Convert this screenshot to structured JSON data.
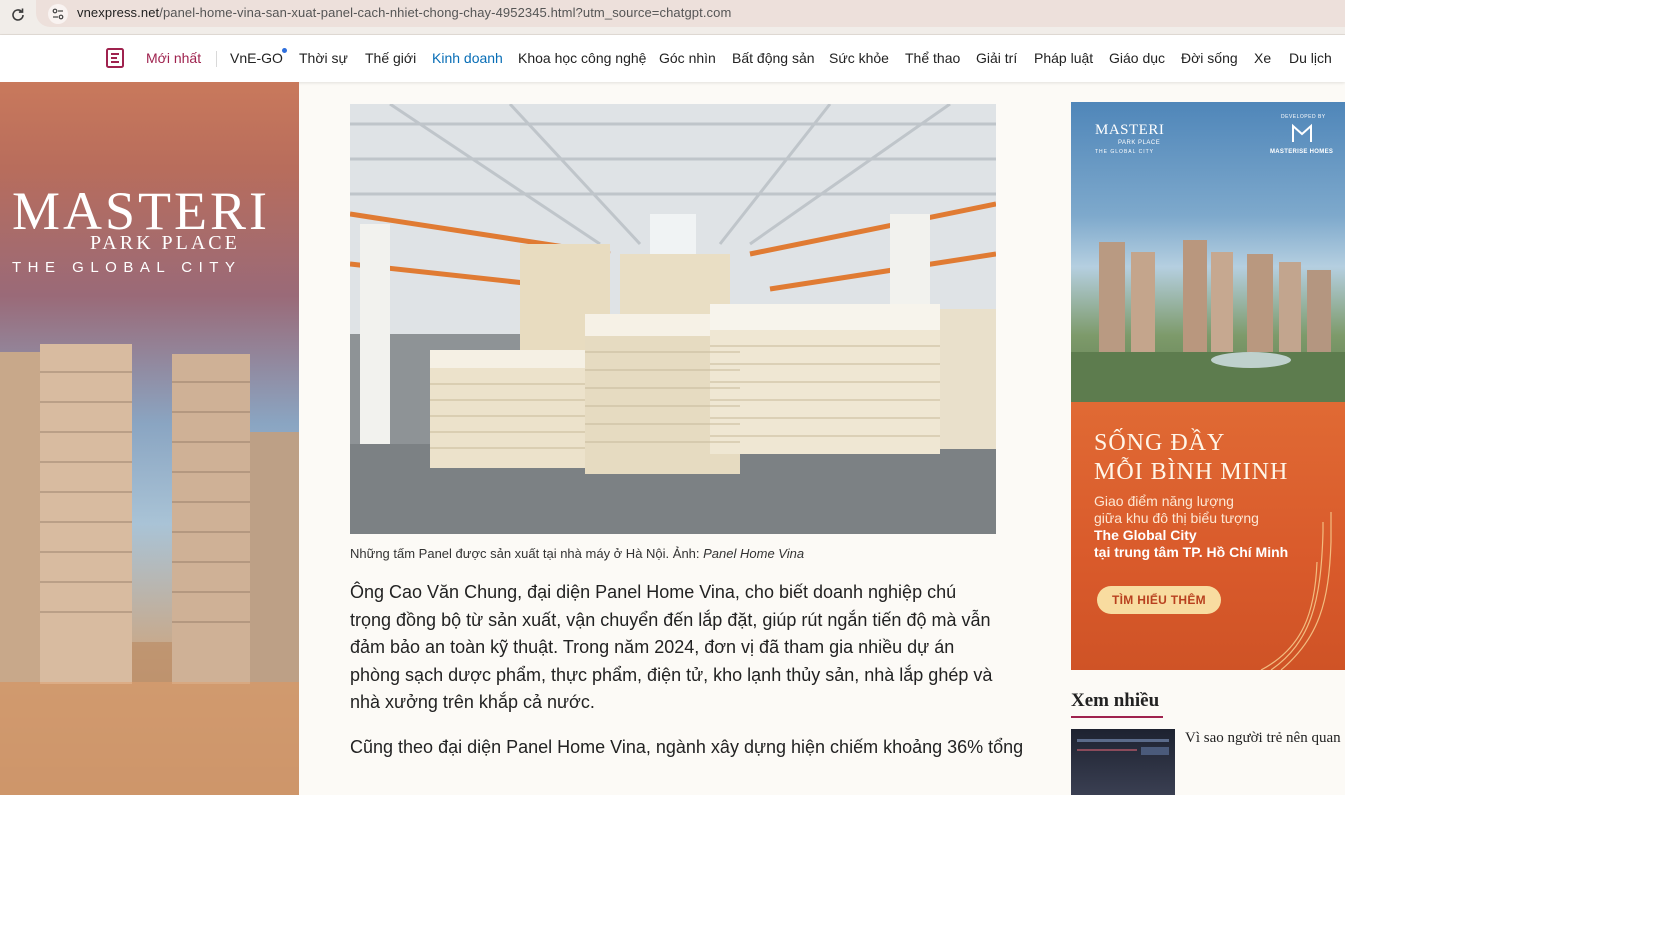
{
  "address_bar": {
    "url_host": "vnexpress.net",
    "url_path": "/panel-home-vina-san-xuat-panel-cach-nhiet-chong-chay-4952345.html?utm_source=chatgpt.com"
  },
  "nav": {
    "moi_nhat": "Mới nhất",
    "items": [
      "VnE-GO",
      "Thời sự",
      "Thế giới",
      "Kinh doanh",
      "Khoa học công nghệ",
      "Góc nhìn",
      "Bất động sản",
      "Sức khỏe",
      "Thể thao",
      "Giải trí",
      "Pháp luật",
      "Giáo dục",
      "Đời sống",
      "Xe",
      "Du lịch"
    ],
    "active": "Kinh doanh"
  },
  "left_ad": {
    "brand": "MASTERI",
    "line2": "PARK PLACE",
    "line3": "THE GLOBAL CITY"
  },
  "article": {
    "caption_text": "Những tấm Panel được sản xuất tại nhà máy ở Hà Nội. Ảnh: ",
    "caption_credit": "Panel Home Vina",
    "paragraph1": "Ông Cao Văn Chung, đại diện Panel Home Vina, cho biết doanh nghiệp chú trọng đồng bộ từ sản xuất, vận chuyển đến lắp đặt, giúp rút ngắn tiến độ mà vẫn đảm bảo an toàn kỹ thuật. Trong năm 2024, đơn vị đã tham gia nhiều dự án phòng sạch dược phẩm, thực phẩm, điện tử, kho lạnh thủy sản, nhà lắp ghép và nhà xưởng trên khắp cả nước.",
    "paragraph2": "Cũng theo đại diện Panel Home Vina, ngành xây dựng hiện chiếm khoảng 36% tổng"
  },
  "right_ad": {
    "logo_name": "MASTERI",
    "logo_sub": "PARK PLACE",
    "logo_sub2": "THE GLOBAL CITY",
    "dev_label": "DEVELOPED BY",
    "dev_name": "MASTERISE HOMES",
    "headline1": "SỐNG ĐẦY",
    "headline2": "MỖI BÌNH MINH",
    "body1": "Giao điểm năng lượng",
    "body2": "giữa khu đô thị biểu tượng",
    "body3": "The Global City",
    "body4": "tại trung tâm TP. Hồ Chí Minh",
    "cta": "TÌM HIỂU THÊM"
  },
  "most_viewed": {
    "title": "Xem nhiều",
    "item1": "Vì sao người trẻ nên quan"
  },
  "colors": {
    "brand": "#9f224e",
    "active_link": "#076db6",
    "ad_orange": "#d95a2b"
  }
}
